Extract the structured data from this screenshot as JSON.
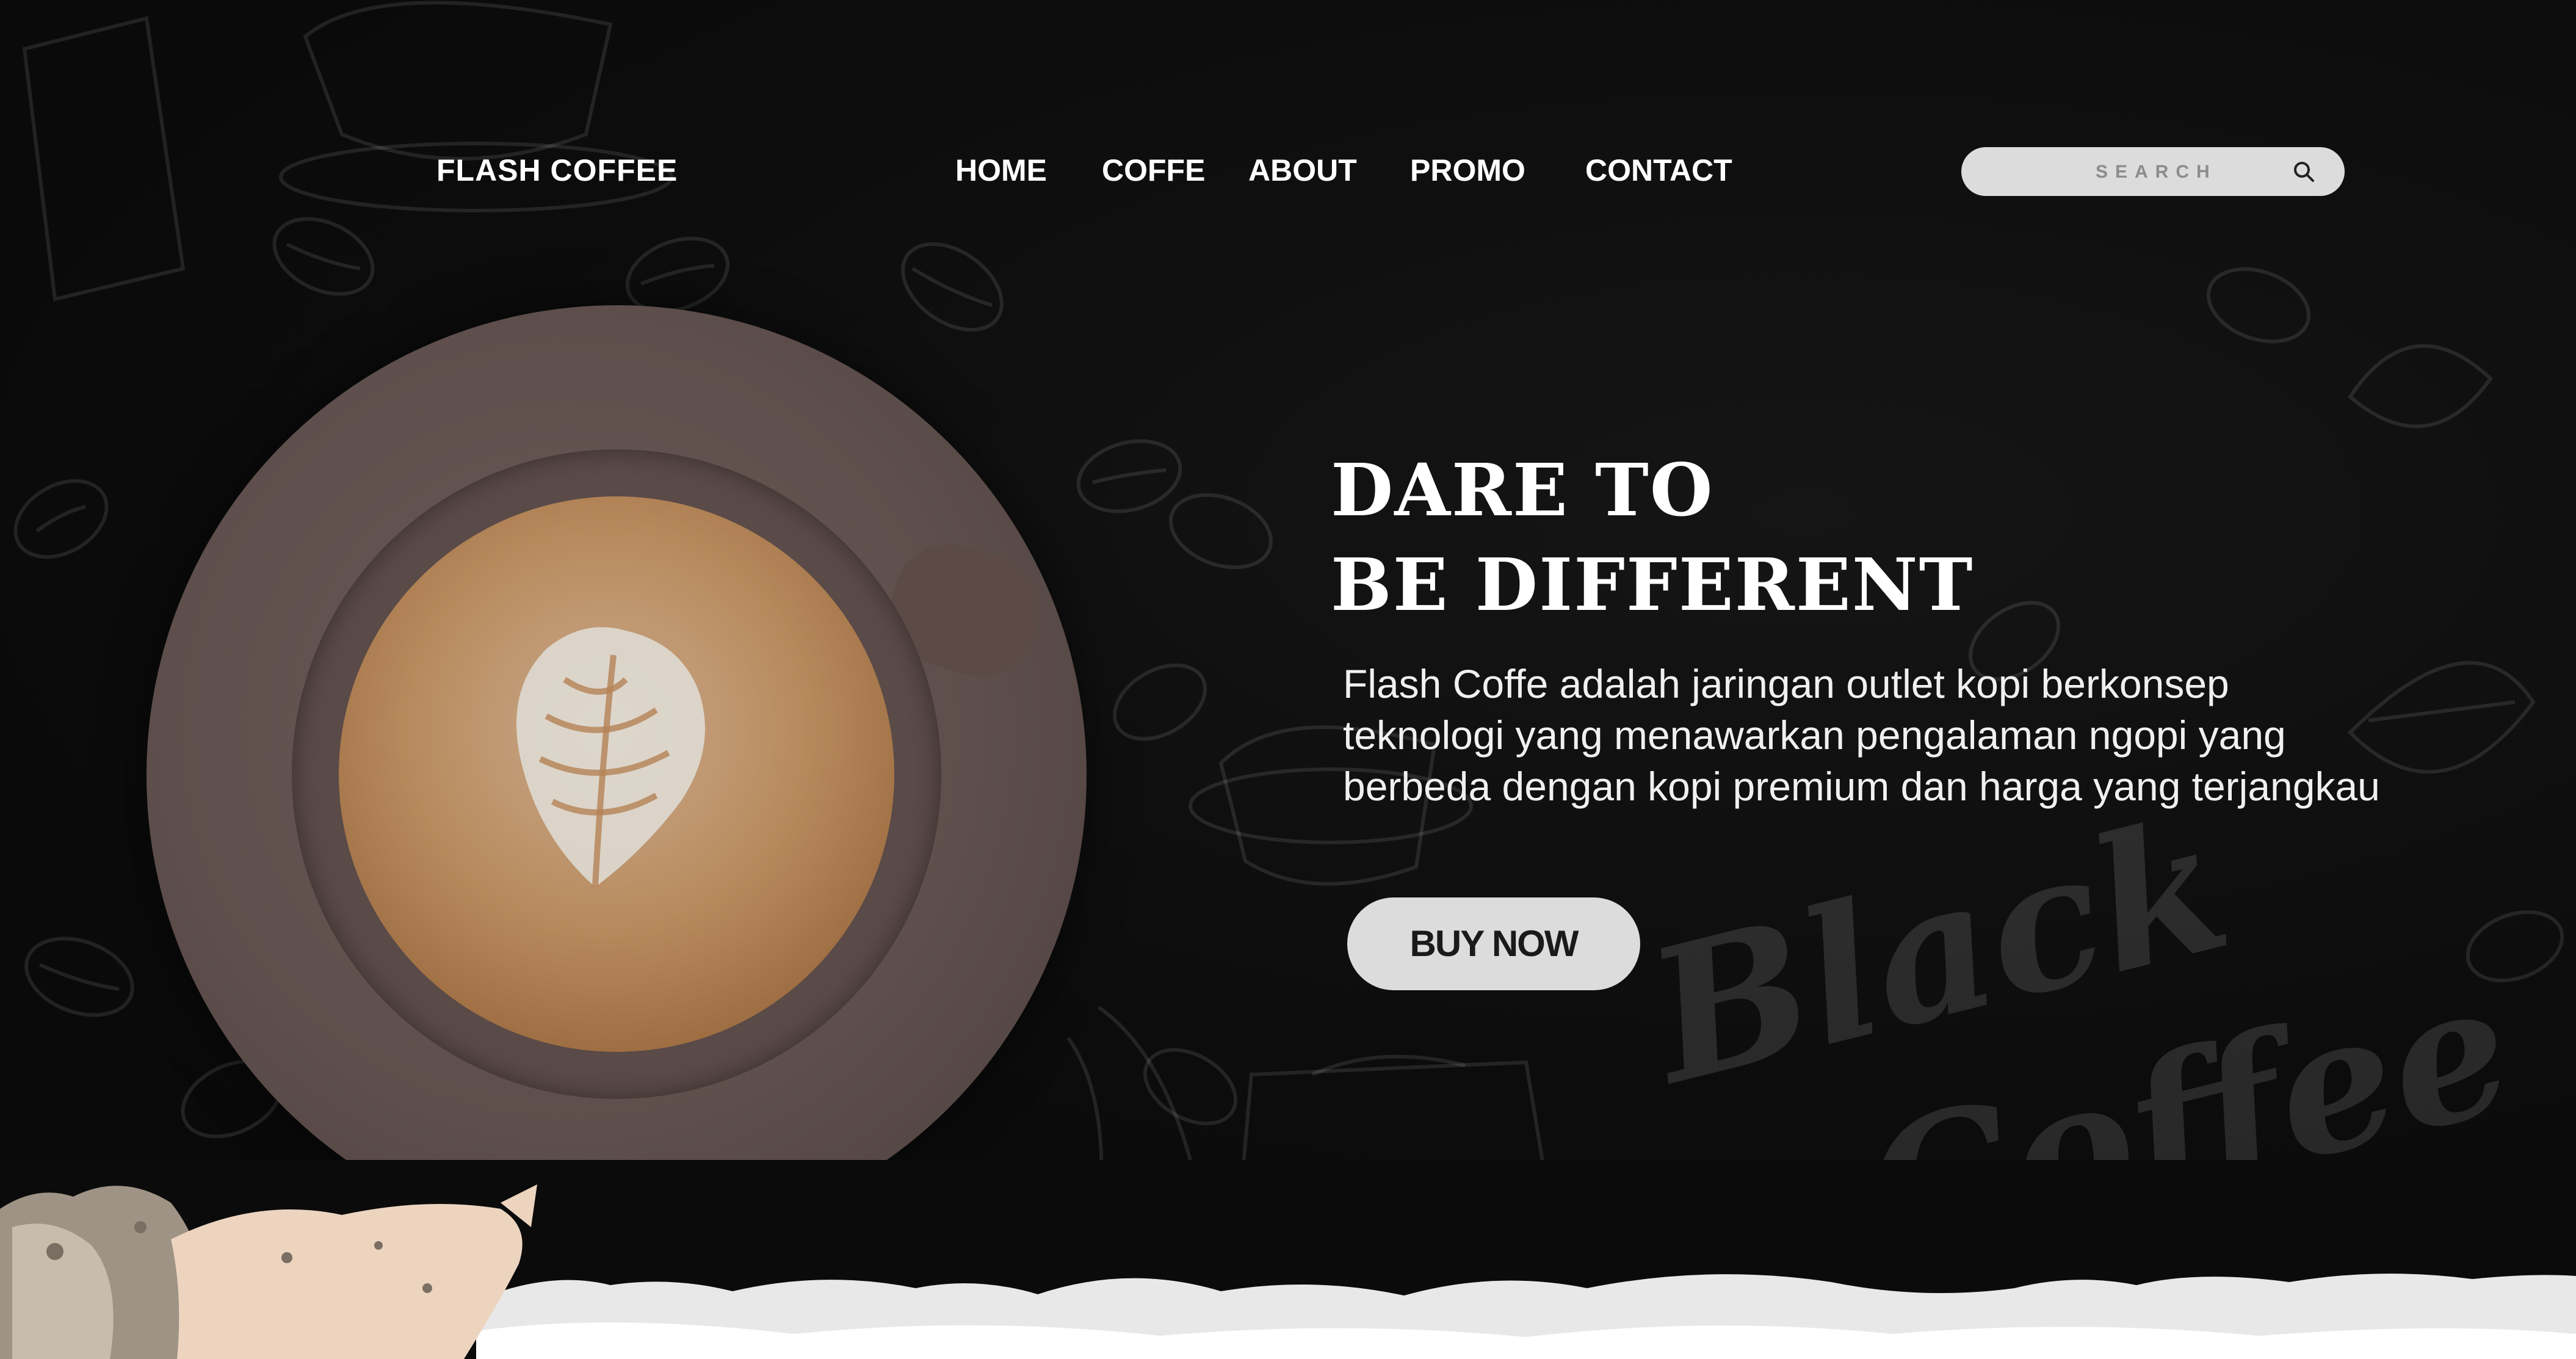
{
  "nav": {
    "logo": "FLASH COFFEE",
    "items": [
      {
        "label": "HOME"
      },
      {
        "label": "COFFE"
      },
      {
        "label": "ABOUT"
      },
      {
        "label": "PROMO"
      },
      {
        "label": "CONTACT"
      }
    ],
    "search_placeholder": "SEARCH",
    "search_icon": "search-icon"
  },
  "hero": {
    "headline_line1": "DARE TO",
    "headline_line2": "BE DIFFERENT",
    "description": "Flash Coffe adalah jaringan outlet kopi berkonsep teknologi yang menawarkan pengalaman ngopi yang berbeda dengan kopi premium dan harga yang terjangkau",
    "cta": "BUY NOW"
  },
  "background": {
    "watermark_line1": "Black",
    "watermark_line2": "Coffee"
  },
  "colors": {
    "background": "#0b0b0b",
    "text": "#ffffff",
    "button": "#dcdcdc",
    "button_text": "#1a1a1a",
    "saucer": "#5e4f4c",
    "coffee": "#b88b5e"
  }
}
